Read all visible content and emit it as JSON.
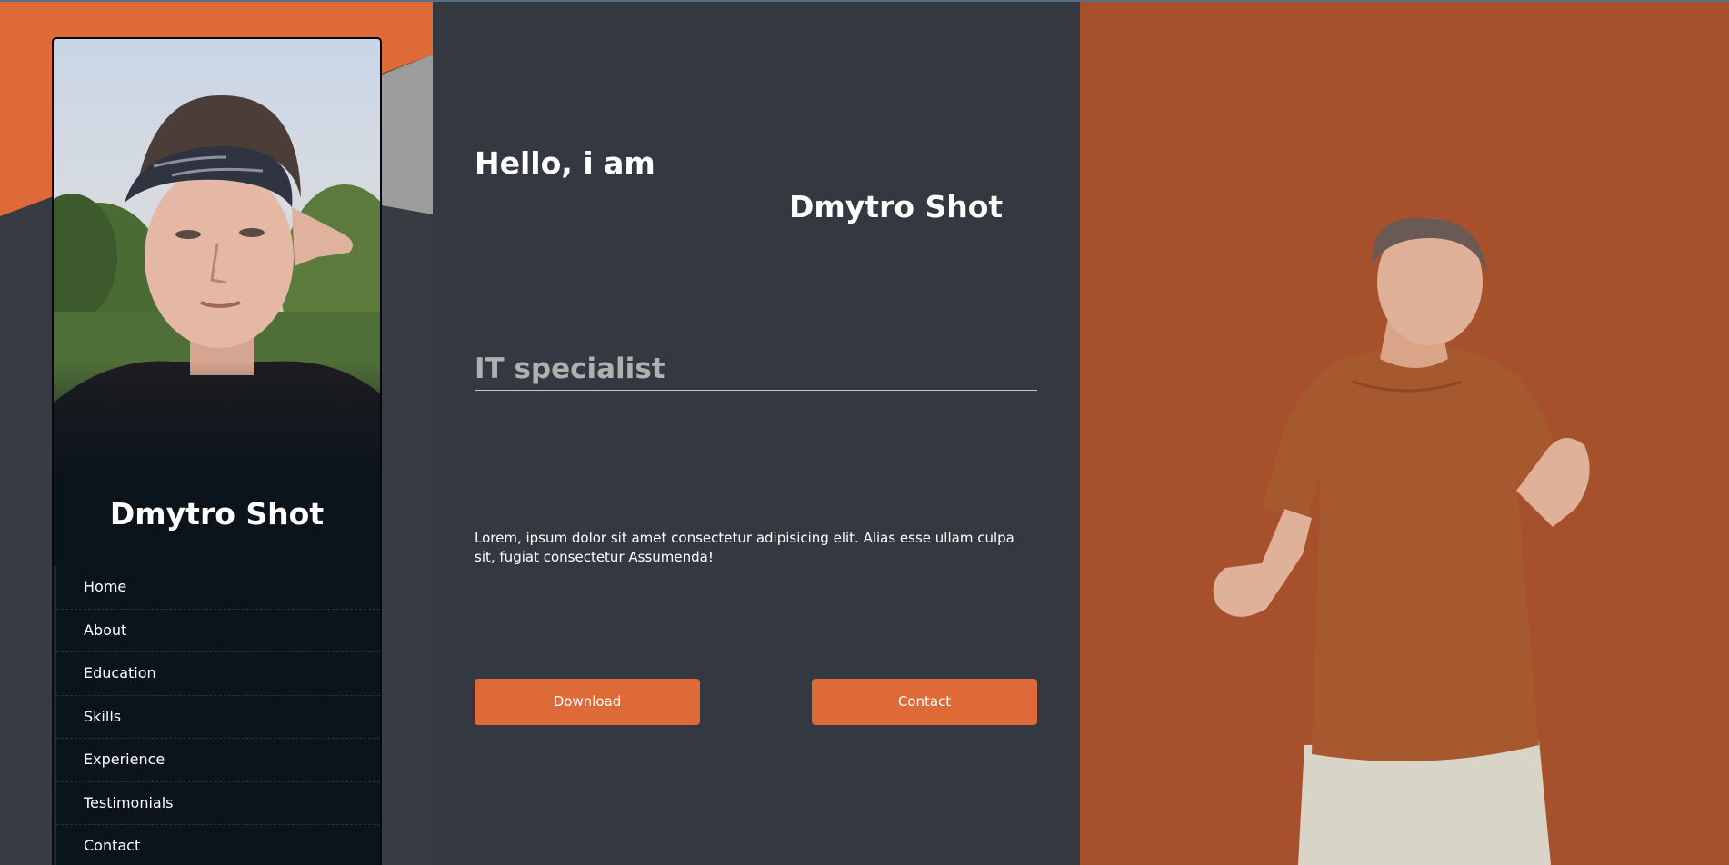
{
  "sidebar": {
    "name": "Dmytro Shot",
    "nav_items": [
      {
        "label": "Home"
      },
      {
        "label": "About"
      },
      {
        "label": "Education"
      },
      {
        "label": "Skills"
      },
      {
        "label": "Experience"
      },
      {
        "label": "Testimonials"
      },
      {
        "label": "Contact"
      }
    ]
  },
  "hero": {
    "greeting": "Hello, i am",
    "name": "Dmytro Shot",
    "role": "IT specialist",
    "description": "Lorem, ipsum dolor sit amet consectetur adipisicing elit. Alias esse ullam culpa sit, fugiat consectetur Assumenda!",
    "download_label": "Download",
    "contact_label": "Contact"
  },
  "colors": {
    "accent": "#dd6a37",
    "right_panel": "#a6512c",
    "middle_panel": "#343840",
    "sidebar_card": "#0b131b"
  }
}
